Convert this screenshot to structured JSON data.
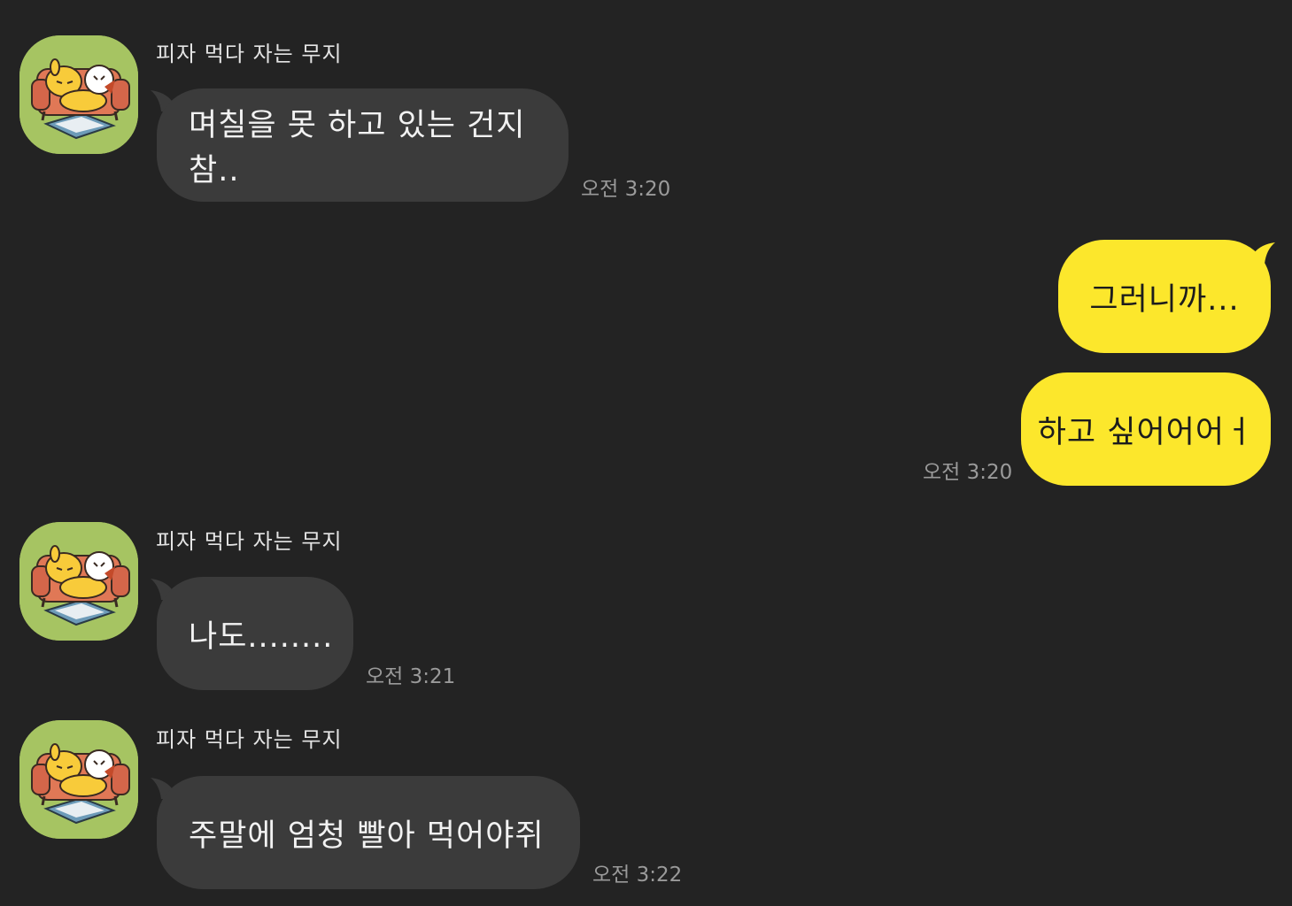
{
  "chat": {
    "messages": [
      {
        "sender": "피자 먹다 자는 무지",
        "avatar_icon": "muzi-pizza-sleeping-avatar-icon",
        "text": "며칠을 못 하고 있는 건지 참..",
        "time": "오전 3:20"
      },
      {
        "text": "그러니까..."
      },
      {
        "text": "하고 싶어어어ㅓ",
        "time": "오전 3:20"
      },
      {
        "sender": "피자 먹다 자는 무지",
        "avatar_icon": "muzi-pizza-sleeping-avatar-icon",
        "text": "나도........",
        "time": "오전 3:21"
      },
      {
        "sender": "피자 먹다 자는 무지",
        "avatar_icon": "muzi-pizza-sleeping-avatar-icon",
        "text": "주말에 엄청 빨아 먹어야쥐",
        "time": "오전 3:22"
      }
    ]
  },
  "colors": {
    "background": "#232323",
    "incoming_bubble": "#3b3b3b",
    "outgoing_bubble": "#fce72c",
    "avatar_background": "#a6c462",
    "timestamp": "#9a9a9a"
  }
}
